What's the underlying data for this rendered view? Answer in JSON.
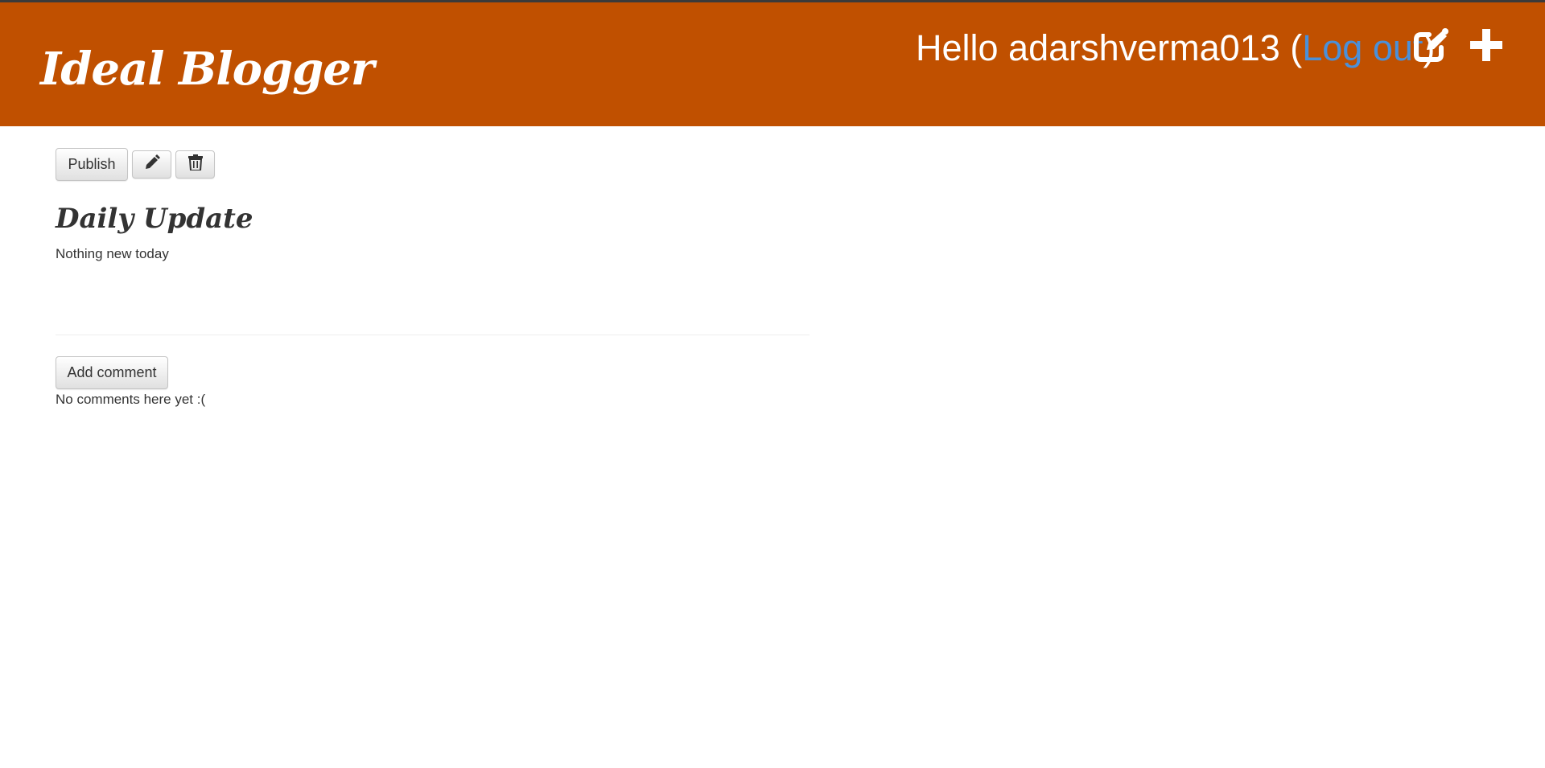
{
  "header": {
    "brand": "Ideal Blogger",
    "greeting_prefix": "Hello adarshverma013 (",
    "logout_label": "Log out",
    "greeting_suffix": ")",
    "new_post_icon": "edit-square-icon",
    "add_icon": "plus-icon",
    "background_color": "#c05000",
    "link_color": "#4a90d9"
  },
  "toolbar": {
    "publish_label": "Publish",
    "edit_icon": "pencil-icon",
    "delete_icon": "trash-icon"
  },
  "post": {
    "title": "Daily Update",
    "body": "Nothing new today"
  },
  "comments": {
    "add_label": "Add comment",
    "empty_text": "No comments here yet :("
  }
}
